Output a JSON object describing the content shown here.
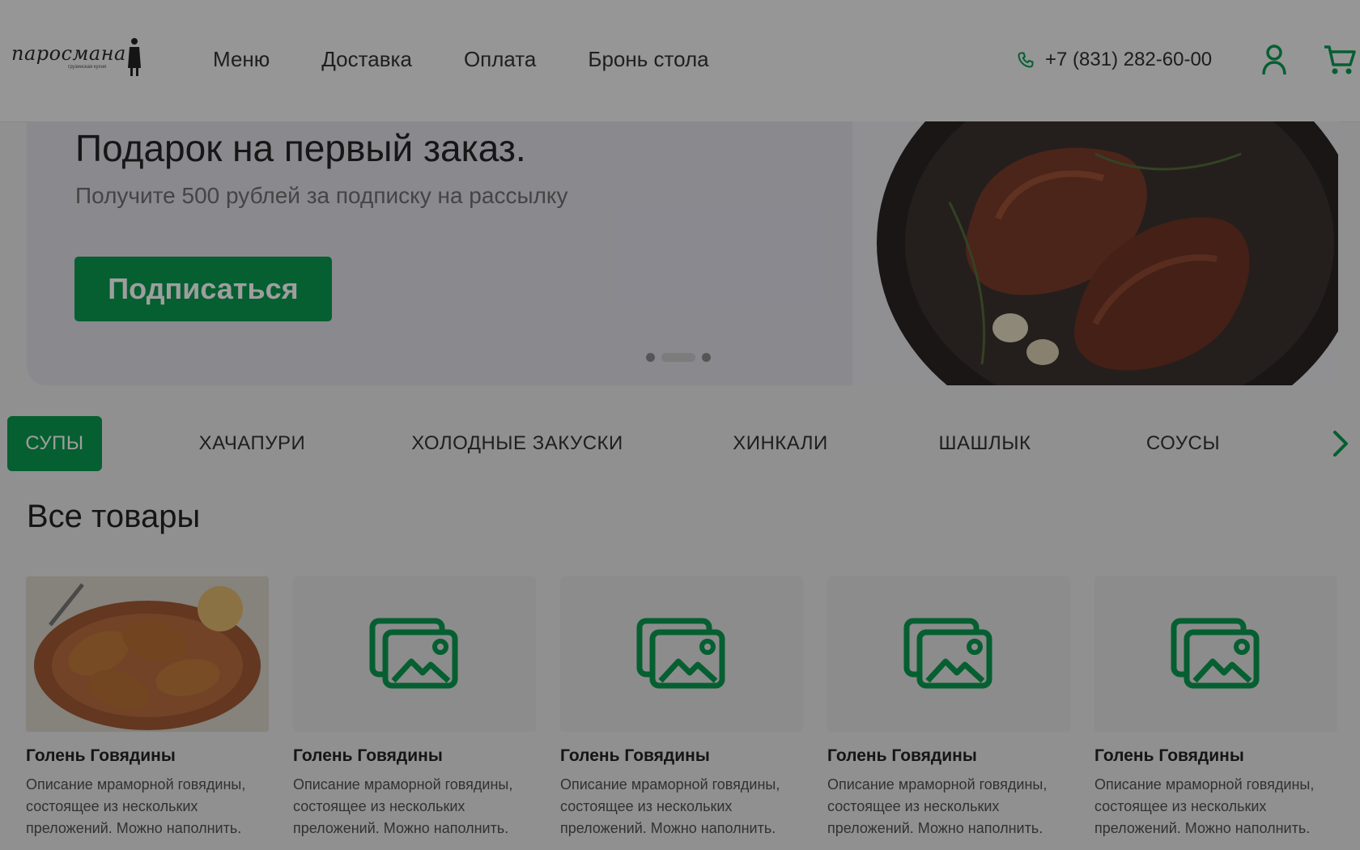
{
  "header": {
    "logo_text": "паросмана",
    "logo_subtext": "грузинская кухня",
    "nav": [
      "Меню",
      "Доставка",
      "Оплата",
      "Бронь стола"
    ],
    "phone": "+7 (831) 282-60-00",
    "icons": [
      "phone-icon",
      "user-icon",
      "cart-icon"
    ]
  },
  "banner": {
    "title": "Подарок на первый заказ.",
    "subtitle": "Получите 500 рублей за подписку на рассылку",
    "button": "Подписаться",
    "slides": 3,
    "active_slide": 2
  },
  "categories": {
    "items": [
      "СУПЫ",
      "ХАЧАПУРИ",
      "ХОЛОДНЫЕ ЗАКУСКИ",
      "ХИНКАЛИ",
      "ШАШЛЫК",
      "СОУСЫ"
    ],
    "active": "СУПЫ"
  },
  "section": {
    "title": "Все товары"
  },
  "products": [
    {
      "title": "Голень Говядины",
      "desc": "Описание мраморной говядины, состоящее из нескольких преложений. Можно наполнить."
    },
    {
      "title": "Голень Говядины",
      "desc": "Описание мраморной говядины, состоящее из нескольких преложений. Можно наполнить."
    },
    {
      "title": "Голень Говядины",
      "desc": "Описание мраморной говядины, состоящее из нескольких преложений. Можно наполнить."
    },
    {
      "title": "Голень Говядины",
      "desc": "Описание мраморной говядины, состоящее из нескольких преложений. Можно наполнить."
    },
    {
      "title": "Голень Говядины",
      "desc": "Описание мраморной говядины, состоящее из нескольких преложений. Можно наполнить."
    }
  ],
  "colors": {
    "accent": "#0a9a50",
    "overlay": "rgba(0,0,0,0.38)"
  }
}
